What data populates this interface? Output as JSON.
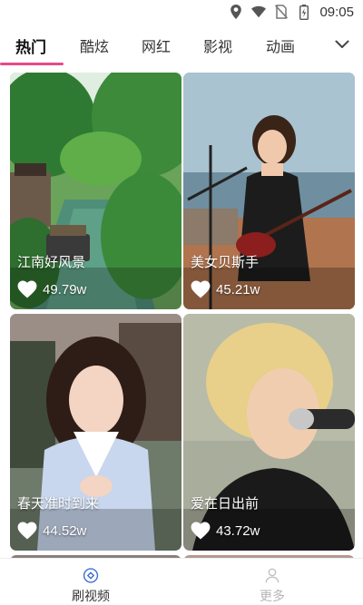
{
  "status_bar": {
    "time": "09:05",
    "icons": [
      "location-icon",
      "wifi-icon",
      "sim-off-icon",
      "battery-icon"
    ]
  },
  "tabs": [
    {
      "label": "热门",
      "active": true
    },
    {
      "label": "酷炫",
      "active": false
    },
    {
      "label": "网红",
      "active": false
    },
    {
      "label": "影视",
      "active": false
    },
    {
      "label": "动画",
      "active": false
    }
  ],
  "tab_more_icon": "chevron-down-icon",
  "accent_color": "#e84a8a",
  "cards": [
    {
      "title": "江南好风景",
      "likes": "49.79w"
    },
    {
      "title": "美女贝斯手",
      "likes": "45.21w"
    },
    {
      "title": "春天准时到来",
      "likes": "44.52w"
    },
    {
      "title": "爱在日出前",
      "likes": "43.72w"
    }
  ],
  "bottom_nav": [
    {
      "label": "刷视频",
      "icon": "play-circle-icon",
      "active": true
    },
    {
      "label": "更多",
      "icon": "user-icon",
      "active": false
    }
  ]
}
